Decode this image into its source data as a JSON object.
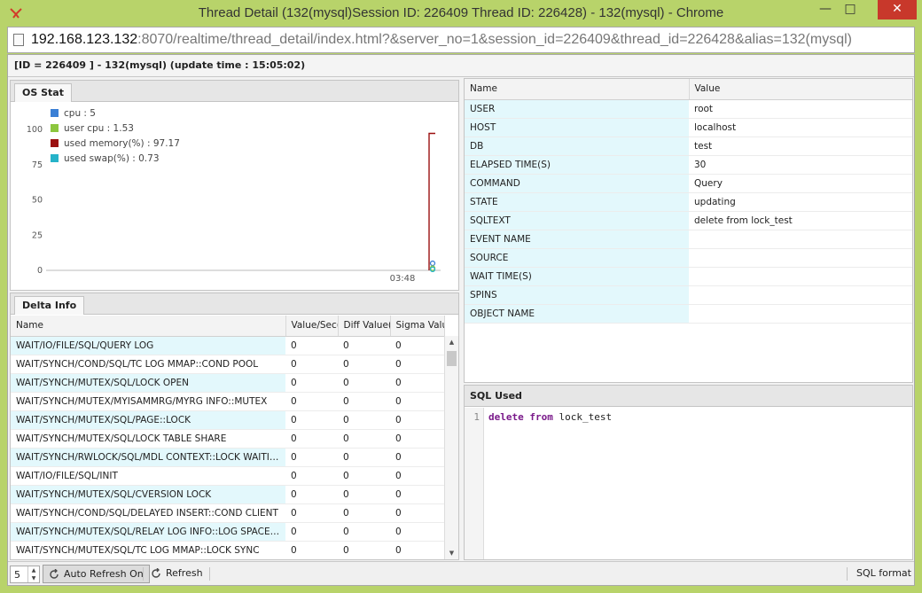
{
  "window": {
    "title": "Thread Detail (132(mysql)Session ID: 226409 Thread ID: 226428) - 132(mysql) - Chrome",
    "minimize": "—",
    "maximize": "□",
    "close": "✕"
  },
  "address": {
    "host": "192.168.123.132",
    "rest": ":8070/realtime/thread_detail/index.html?&server_no=1&session_id=226409&thread_id=226428&alias=132(mysql)"
  },
  "header": {
    "text": "[ID = 226409 ] - 132(mysql) (update time : 15:05:02)"
  },
  "os_stat": {
    "tab_label": "OS Stat",
    "legend": [
      {
        "label": "cpu : 5",
        "color": "#3a7fd5"
      },
      {
        "label": "user cpu : 1.53",
        "color": "#8cc63e"
      },
      {
        "label": "used memory(%) : 97.17",
        "color": "#9b1010"
      },
      {
        "label": "used swap(%) : 0.73",
        "color": "#26b3c9"
      }
    ]
  },
  "chart_data": {
    "type": "line",
    "y_ticks": [
      "100",
      "75",
      "50",
      "25",
      "0"
    ],
    "x_ticks": [
      "03:48"
    ],
    "ylim": [
      0,
      100
    ],
    "series": [
      {
        "name": "cpu",
        "color": "#3a7fd5",
        "values": [
          5
        ]
      },
      {
        "name": "user cpu",
        "color": "#8cc63e",
        "values": [
          1.53
        ]
      },
      {
        "name": "used memory(%)",
        "color": "#9b1010",
        "values": [
          97.17
        ]
      },
      {
        "name": "used swap(%)",
        "color": "#26b3c9",
        "values": [
          0.73
        ]
      }
    ],
    "grid": false,
    "legend_position": "top-left"
  },
  "delta_info": {
    "tab_label": "Delta Info",
    "columns": [
      "Name",
      "Value/Sec(",
      "Diff Value(",
      "Sigma Valu"
    ],
    "rows": [
      [
        "WAIT/IO/FILE/SQL/QUERY LOG",
        "0",
        "0",
        "0"
      ],
      [
        "WAIT/SYNCH/COND/SQL/TC LOG MMAP::COND POOL",
        "0",
        "0",
        "0"
      ],
      [
        "WAIT/SYNCH/MUTEX/SQL/LOCK OPEN",
        "0",
        "0",
        "0"
      ],
      [
        "WAIT/SYNCH/MUTEX/MYISAMMRG/MYRG INFO::MUTEX",
        "0",
        "0",
        "0"
      ],
      [
        "WAIT/SYNCH/MUTEX/SQL/PAGE::LOCK",
        "0",
        "0",
        "0"
      ],
      [
        "WAIT/SYNCH/MUTEX/SQL/LOCK TABLE SHARE",
        "0",
        "0",
        "0"
      ],
      [
        "WAIT/SYNCH/RWLOCK/SQL/MDL CONTEXT::LOCK WAITIN...",
        "0",
        "0",
        "0"
      ],
      [
        "WAIT/IO/FILE/SQL/INIT",
        "0",
        "0",
        "0"
      ],
      [
        "WAIT/SYNCH/MUTEX/SQL/CVERSION LOCK",
        "0",
        "0",
        "0"
      ],
      [
        "WAIT/SYNCH/COND/SQL/DELAYED INSERT::COND CLIENT",
        "0",
        "0",
        "0"
      ],
      [
        "WAIT/SYNCH/MUTEX/SQL/RELAY LOG INFO::LOG SPACE L...",
        "0",
        "0",
        "0"
      ],
      [
        "WAIT/SYNCH/MUTEX/SQL/TC LOG MMAP::LOCK SYNC",
        "0",
        "0",
        "0"
      ]
    ]
  },
  "props": {
    "columns": [
      "Name",
      "Value"
    ],
    "rows": [
      [
        "USER",
        "root"
      ],
      [
        "HOST",
        "localhost"
      ],
      [
        "DB",
        "test"
      ],
      [
        "ELAPSED TIME(S)",
        "30"
      ],
      [
        "COMMAND",
        "Query"
      ],
      [
        "STATE",
        "updating"
      ],
      [
        "SQLTEXT",
        "delete from lock_test"
      ],
      [
        "EVENT NAME",
        ""
      ],
      [
        "SOURCE",
        ""
      ],
      [
        "WAIT TIME(S)",
        ""
      ],
      [
        "SPINS",
        ""
      ],
      [
        "OBJECT NAME",
        ""
      ]
    ]
  },
  "sql_used": {
    "title": "SQL Used",
    "line_number": "1",
    "kw1": "delete",
    "kw2": "from",
    "rest": "lock_test"
  },
  "statusbar": {
    "interval": "5",
    "auto_refresh": "Auto Refresh On",
    "refresh": "Refresh",
    "sql_format": "SQL format"
  }
}
